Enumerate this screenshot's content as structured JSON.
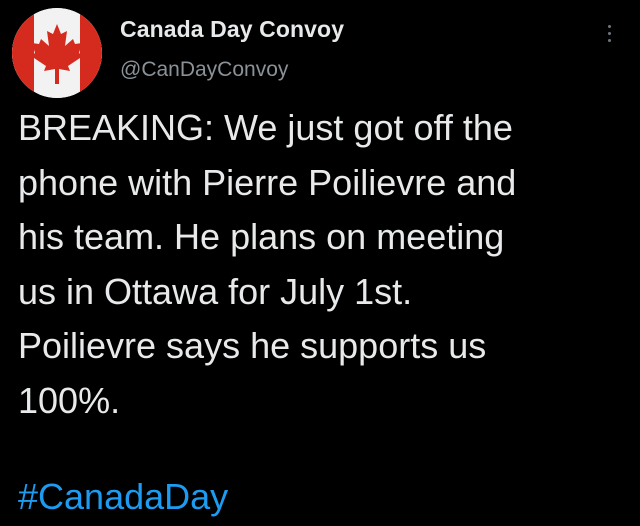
{
  "author": {
    "display_name": "Canada Day Convoy",
    "handle": "@CanDayConvoy",
    "avatar_icon": "canada-maple-leaf-flag-icon"
  },
  "more_icon": "more-options-vertical-dots-icon",
  "tweet": {
    "lines": [
      "BREAKING: We just got off the",
      "phone with Pierre Poilievre and",
      "his team. He plans on meeting",
      "us in Ottawa for July 1st.",
      "Poilievre says he supports us",
      "100%."
    ],
    "hashtag": "#CanadaDay"
  },
  "colors": {
    "background": "#000000",
    "text": "#e7e9ea",
    "secondary_text": "#8b9297",
    "link": "#1d9bf0",
    "flag_red": "#d52b1e"
  }
}
